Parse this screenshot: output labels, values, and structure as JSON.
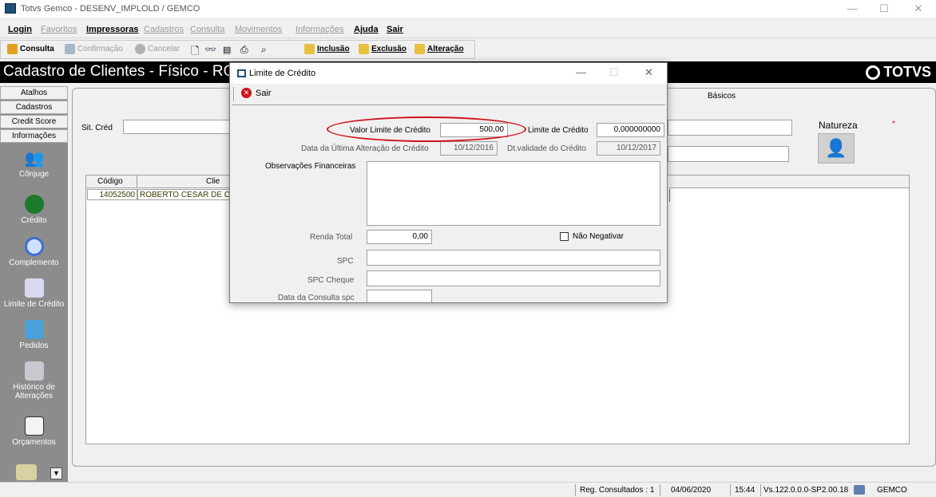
{
  "window": {
    "title": "Totvs Gemco - DESENV_IMPLOLD / GEMCO",
    "minimize": "—",
    "maximize": "☐",
    "close": "✕"
  },
  "menu": {
    "items": [
      {
        "label": "Login",
        "enabled": true
      },
      {
        "label": "Favoritos",
        "enabled": false
      },
      {
        "label": "Impressoras",
        "enabled": true
      },
      {
        "label": "Cadastros",
        "enabled": false
      },
      {
        "label": "Consulta",
        "enabled": false
      },
      {
        "label": "Movimentos",
        "enabled": false
      },
      {
        "label": "Informações",
        "enabled": false
      },
      {
        "label": "Ajuda",
        "enabled": true
      },
      {
        "label": "Sair",
        "enabled": true
      }
    ]
  },
  "toolbar": {
    "consulta": "Consulta",
    "confirmacao": "Confirmação",
    "cancelar": "Cancelar",
    "inclusao": "Inclusão",
    "exclusao": "Exclusão",
    "alteracao": "Alteração"
  },
  "header": {
    "title": "Cadastro de Clientes - Físico  - ROE",
    "logo": "TOTVS"
  },
  "sidebar": {
    "tabs": [
      "Atalhos",
      "Cadastros",
      "Credit Score",
      "Informações"
    ],
    "buttons": [
      {
        "label": "Cônjuge",
        "icon": "people-icon"
      },
      {
        "label": "Crédito",
        "icon": "money-bag-icon"
      },
      {
        "label": "Complemento",
        "icon": "magnifier-icon"
      },
      {
        "label": "Limite de Crédito",
        "icon": "notepad-pen-icon"
      },
      {
        "label": "Pedidos",
        "icon": "handshake-icon"
      },
      {
        "label": "Histórico de Alterações",
        "icon": "pen-paper-icon"
      },
      {
        "label": "Orçamentos",
        "icon": "document-icon"
      }
    ]
  },
  "main": {
    "tab_basicos": "Básicos",
    "sit_cred_label": "Sit. Créd",
    "natureza_label": "Natureza",
    "grid": {
      "headers": [
        "Código",
        "Clie"
      ],
      "rows": [
        [
          "14052500",
          "ROBERTO CESAR DE C"
        ]
      ]
    }
  },
  "dialog": {
    "title": "Limite de Crédito",
    "sair": "Sair",
    "valor_limite_label": "Valor Limite de Crédito",
    "valor_limite_value": "500,00",
    "limite_label": "Limite de Crédito",
    "limite_value": "0,000000000",
    "ultima_alteracao_label": "Data da Última Alteração de Crédito",
    "ultima_alteracao_value": "10/12/2016",
    "validade_label": "Dt.validade do Crédito",
    "validade_value": "10/12/2017",
    "obs_label": "Observações Financeiras",
    "renda_label": "Renda Total",
    "renda_value": "0,00",
    "nao_negativar_label": "Não Negativar",
    "spc_label": "SPC",
    "spc_cheque_label": "SPC Cheque",
    "data_consulta_label": "Data da Consulta spc"
  },
  "status": {
    "reg": "Reg. Consultados : 1",
    "date": "04/06/2020",
    "time": "15:44",
    "version": "Vs.122.0.0.0-SP2.00.18",
    "user": "GEMCO"
  },
  "colors": {
    "header_bg": "#000000",
    "sidebar_bg": "#8c8c8c",
    "highlight_oval": "#d0121b"
  }
}
